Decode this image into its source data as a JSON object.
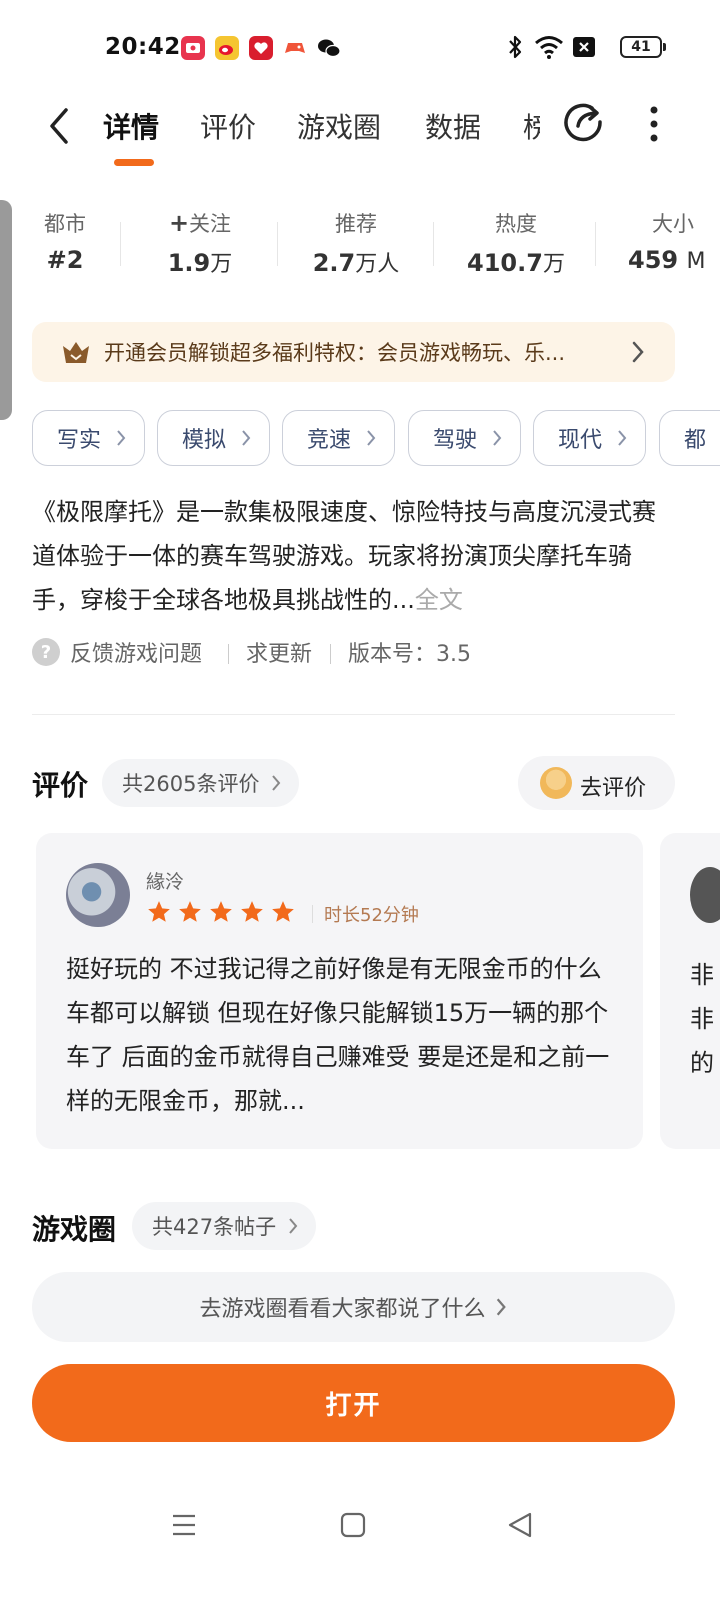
{
  "status_bar": {
    "time": "20:42",
    "battery": "41",
    "notification_icons": [
      "video-app-icon",
      "weibo-icon",
      "gift-app-icon",
      "game-app-icon",
      "wechat-icon"
    ],
    "right_icons": [
      "bluetooth-icon",
      "wifi-icon",
      "close-box-icon",
      "battery-icon"
    ]
  },
  "header": {
    "tabs": [
      {
        "label": "详情",
        "active": true
      },
      {
        "label": "评价"
      },
      {
        "label": "游戏圈"
      },
      {
        "label": "数据"
      },
      {
        "label": "榜"
      }
    ]
  },
  "stats": [
    {
      "label": "都市",
      "value": "#2",
      "unit": ""
    },
    {
      "label": "关注",
      "value": "1.9",
      "unit": "万",
      "has_plus": true
    },
    {
      "label": "推荐",
      "value": "2.7",
      "unit": "万人"
    },
    {
      "label": "热度",
      "value": "410.7",
      "unit": "万"
    },
    {
      "label": "大小",
      "value": "459",
      "unit": "M"
    }
  ],
  "vip_banner": {
    "text": "开通会员解锁超多福利特权：会员游戏畅玩、乐..."
  },
  "tags": [
    "写实",
    "模拟",
    "竞速",
    "驾驶",
    "现代",
    "都"
  ],
  "description": {
    "text": "《极限摩托》是一款集极限速度、惊险特技与高度沉浸式赛道体验于一体的赛车驾驶游戏。玩家将扮演顶尖摩托车骑手，穿梭于全球各地极具挑战性的...",
    "more": "全文"
  },
  "feedback": {
    "report": "反馈游戏问题",
    "request_update": "求更新",
    "version": "版本号：3.5"
  },
  "reviews": {
    "title": "评价",
    "count": "共2605条评价",
    "write_button": "去评价",
    "items": [
      {
        "user": "緣泠",
        "rating": 5,
        "duration": "时长52分钟",
        "text": "挺好玩的  不过我记得之前好像是有无限金币的什么车都可以解锁  但现在好像只能解锁15万一辆的那个车了 后面的金币就得自己赚难受  要是还是和之前一样的无限金币，那就..."
      }
    ],
    "peek_text": [
      "非",
      "非",
      "的"
    ]
  },
  "game_circle": {
    "title": "游戏圈",
    "count": "共427条帖子",
    "link": "去游戏圈看看大家都说了什么"
  },
  "open_button": "打开",
  "colors": {
    "accent": "#f26a1b",
    "star": "#f26a1b",
    "vip_bg": "#fdf4e7"
  }
}
